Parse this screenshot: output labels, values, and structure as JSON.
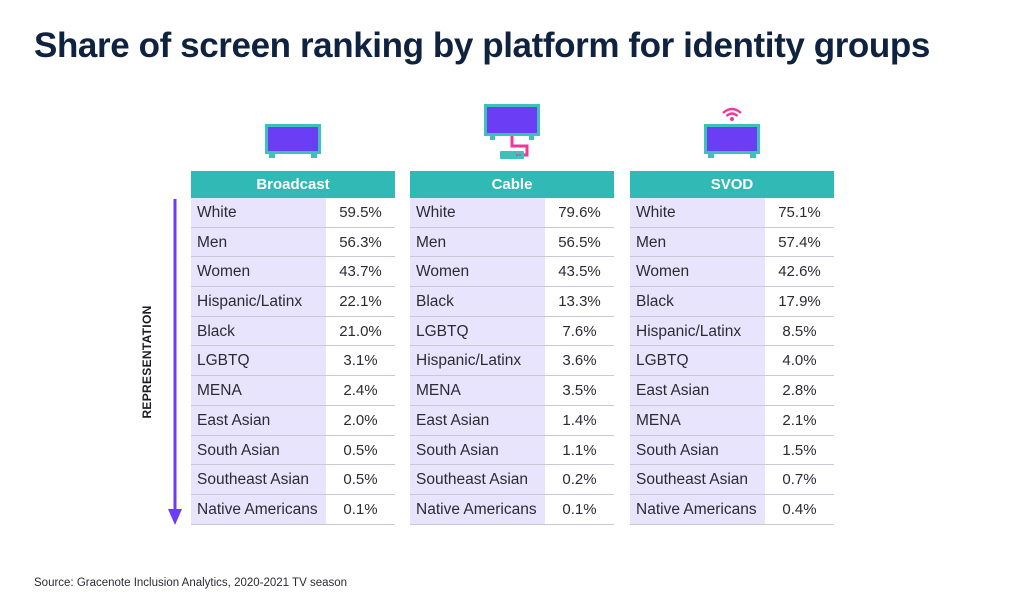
{
  "title": "Share of screen ranking by platform for identity groups",
  "axis_label": "REPRESENTATION",
  "source": "Source: Gracenote Inclusion Analytics, 2020-2021 TV season",
  "colors": {
    "header": "#31b9b5",
    "label_bg": "#e9e4fd",
    "screen": "#6b3df5",
    "tv_frame": "#3ec0bc",
    "accent_pink": "#f0389a",
    "arrow": "#6b3df5",
    "title": "#0f2340"
  },
  "platforms": [
    {
      "name": "Broadcast",
      "icon": "tv-icon"
    },
    {
      "name": "Cable",
      "icon": "tv-cable-box-icon"
    },
    {
      "name": "SVOD",
      "icon": "tv-wifi-icon"
    }
  ],
  "chart_data": {
    "type": "table",
    "title": "Share of screen ranking by platform for identity groups",
    "columns": [
      "Broadcast",
      "Cable",
      "SVOD"
    ],
    "ranking_axis": "REPRESENTATION",
    "tables": [
      {
        "platform": "Broadcast",
        "rows": [
          {
            "group": "White",
            "value": "59.5%"
          },
          {
            "group": "Men",
            "value": "56.3%"
          },
          {
            "group": "Women",
            "value": "43.7%"
          },
          {
            "group": "Hispanic/Latinx",
            "value": "22.1%"
          },
          {
            "group": "Black",
            "value": "21.0%"
          },
          {
            "group": "LGBTQ",
            "value": "3.1%"
          },
          {
            "group": "MENA",
            "value": "2.4%"
          },
          {
            "group": "East Asian",
            "value": "2.0%"
          },
          {
            "group": "South Asian",
            "value": "0.5%"
          },
          {
            "group": "Southeast Asian",
            "value": "0.5%"
          },
          {
            "group": "Native Americans",
            "value": "0.1%"
          }
        ]
      },
      {
        "platform": "Cable",
        "rows": [
          {
            "group": "White",
            "value": "79.6%"
          },
          {
            "group": "Men",
            "value": "56.5%"
          },
          {
            "group": "Women",
            "value": "43.5%"
          },
          {
            "group": "Black",
            "value": "13.3%"
          },
          {
            "group": "LGBTQ",
            "value": "7.6%"
          },
          {
            "group": "Hispanic/Latinx",
            "value": "3.6%"
          },
          {
            "group": "MENA",
            "value": "3.5%"
          },
          {
            "group": "East Asian",
            "value": "1.4%"
          },
          {
            "group": "South Asian",
            "value": "1.1%"
          },
          {
            "group": "Southeast Asian",
            "value": "0.2%"
          },
          {
            "group": "Native Americans",
            "value": "0.1%"
          }
        ]
      },
      {
        "platform": "SVOD",
        "rows": [
          {
            "group": "White",
            "value": "75.1%"
          },
          {
            "group": "Men",
            "value": "57.4%"
          },
          {
            "group": "Women",
            "value": "42.6%"
          },
          {
            "group": "Black",
            "value": "17.9%"
          },
          {
            "group": "Hispanic/Latinx",
            "value": "8.5%"
          },
          {
            "group": "LGBTQ",
            "value": "4.0%"
          },
          {
            "group": "East Asian",
            "value": "2.8%"
          },
          {
            "group": "MENA",
            "value": "2.1%"
          },
          {
            "group": "South Asian",
            "value": "1.5%"
          },
          {
            "group": "Southeast Asian",
            "value": "0.7%"
          },
          {
            "group": "Native Americans",
            "value": "0.4%"
          }
        ]
      }
    ]
  }
}
